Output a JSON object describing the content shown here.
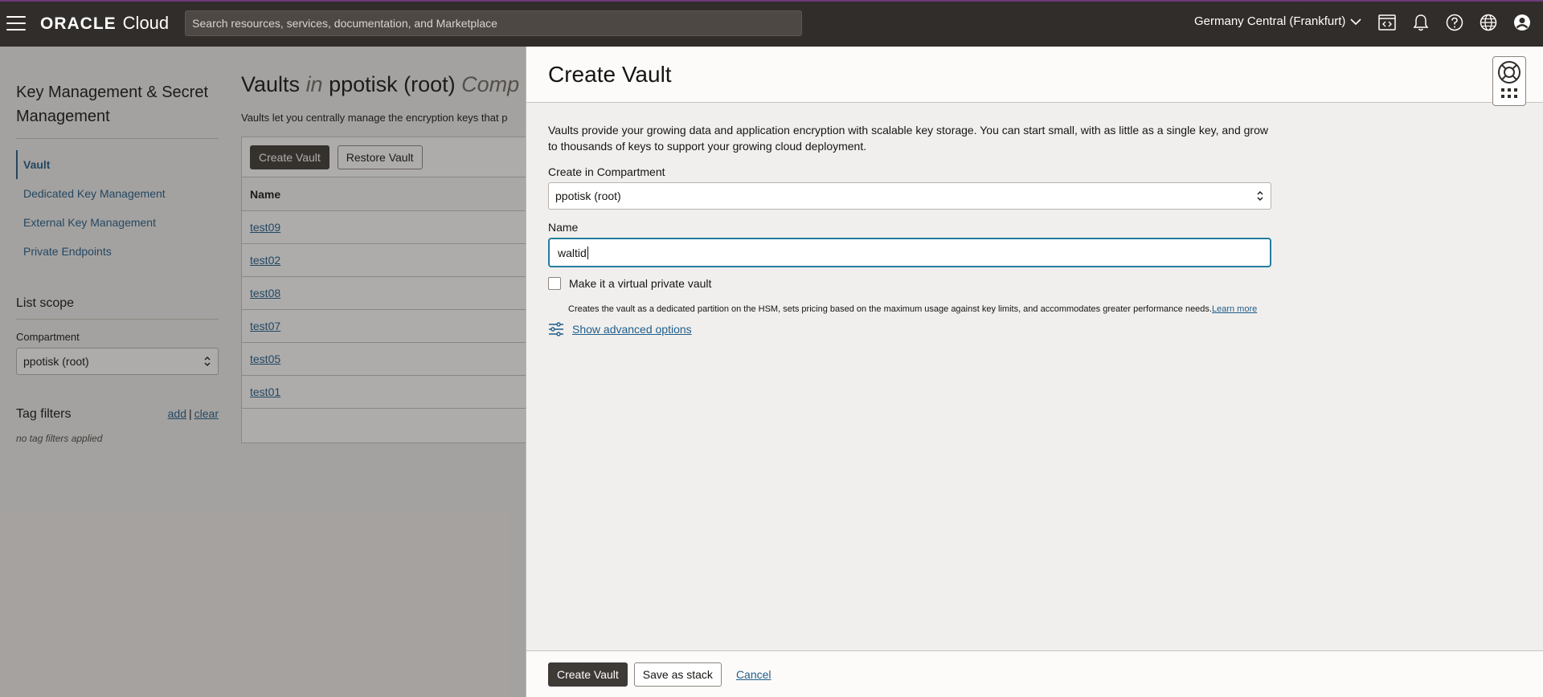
{
  "topbar": {
    "brand_oracle": "ORACLE",
    "brand_cloud": "Cloud",
    "search_placeholder": "Search resources, services, documentation, and Marketplace",
    "region": "Germany Central (Frankfurt)",
    "accent_color": "#6b3a7a",
    "icons": [
      "menu-icon",
      "code-editor-icon",
      "bell-icon",
      "help-icon",
      "globe-icon",
      "profile-icon"
    ]
  },
  "leftnav": {
    "title": "Key Management & Secret Management",
    "items": [
      {
        "label": "Vault",
        "active": true
      },
      {
        "label": "Dedicated Key Management",
        "active": false
      },
      {
        "label": "External Key Management",
        "active": false
      },
      {
        "label": "Private Endpoints",
        "active": false
      }
    ],
    "list_scope": "List scope",
    "compartment_label": "Compartment",
    "compartment_value": "ppotisk (root)",
    "tag_filters": "Tag filters",
    "tag_add": "add",
    "tag_sep": "|",
    "tag_clear": "clear",
    "no_tags": "no tag filters applied"
  },
  "main": {
    "title_pre": "Vaults",
    "title_in": "in",
    "title_comp": "ppotisk (root)",
    "title_post": "Comp",
    "description": "Vaults let you centrally manage the encryption keys that p",
    "create_button": "Create Vault",
    "restore_button": "Restore Vault",
    "column_name": "Name",
    "rows": [
      "test09",
      "test02",
      "test08",
      "test07",
      "test05",
      "test01"
    ]
  },
  "panel": {
    "title": "Create Vault",
    "description": "Vaults provide your growing data and application encryption with scalable key storage. You can start small, with as little as a single key, and grow to thousands of keys to support your growing cloud deployment.",
    "compartment_label": "Create in Compartment",
    "compartment_value": "ppotisk (root)",
    "name_label": "Name",
    "name_value": "waltid",
    "virtual_private_label": "Make it a virtual private vault",
    "virtual_private_checked": false,
    "virtual_private_help": "Creates the vault as a dedicated partition on the HSM, sets pricing based on the maximum usage against key limits, and accommodates greater performance needs.",
    "learn_more": "Learn more",
    "advanced_options": "Show advanced options",
    "focus_color": "#227e9e",
    "footer": {
      "create": "Create Vault",
      "save_stack": "Save as stack",
      "cancel": "Cancel"
    }
  }
}
